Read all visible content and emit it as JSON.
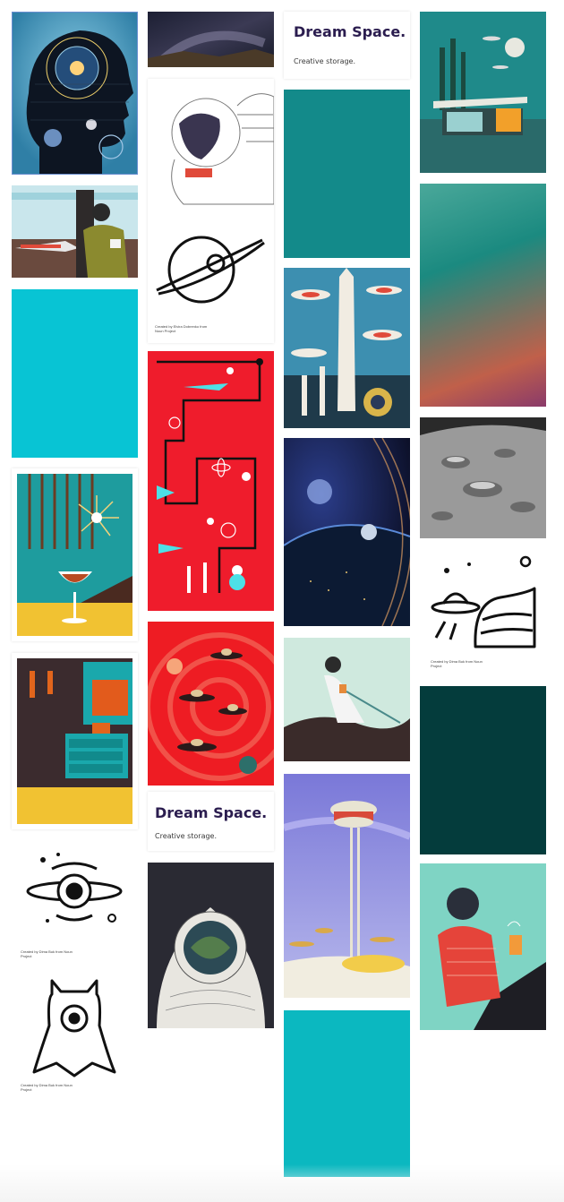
{
  "board": {
    "brand": {
      "title": "Dream Space.",
      "subtitle": "Creative storage."
    },
    "credits": {
      "noun_project": "Created by Dima Buk from Noun Project",
      "noun_project_b": "Created by Elvira Dobrenko from Noun Project"
    },
    "icons": {
      "planet": "planet-icon",
      "astronaut": "astronaut-icon",
      "black_hole": "black-hole-icon",
      "alien": "alien-icon",
      "ufo_planet": "ufo-planet-icon"
    },
    "colors": {
      "teal": "#138a8a",
      "cyan": "#08c4d4",
      "dark_teal": "#043c3c",
      "bright_cyan": "#0bb8c0"
    }
  }
}
